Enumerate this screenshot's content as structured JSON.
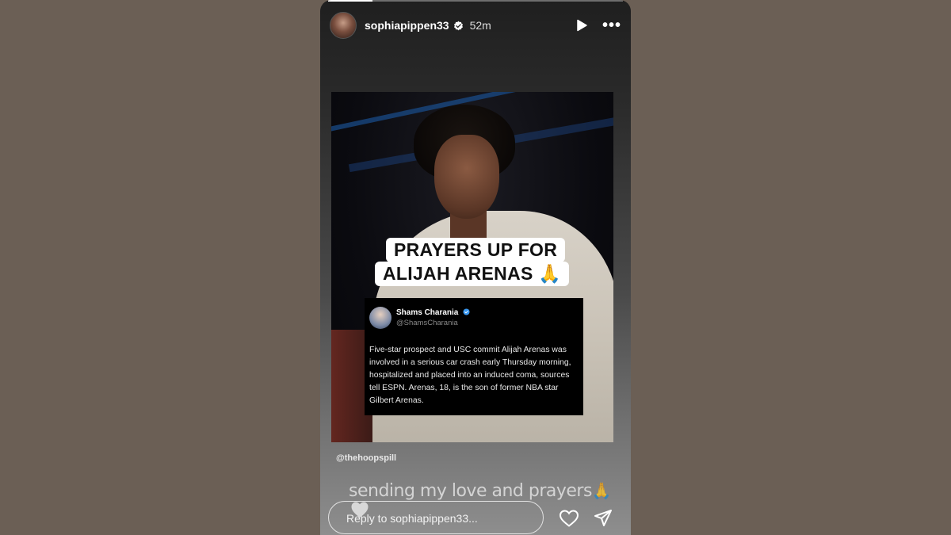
{
  "story": {
    "username": "sophiapippen33",
    "time": "52m",
    "progress_fraction": 0.15,
    "icons": {
      "play": "play-icon",
      "more": "more-icon",
      "verified": "verified-badge-icon"
    }
  },
  "post": {
    "headline_line1": "PRAYERS UP FOR",
    "headline_line2": "ALIJAH ARENAS",
    "headline_emoji": "🙏",
    "tweet": {
      "name": "Shams Charania",
      "handle": "@ShamsCharania",
      "text": "Five-star prospect and USC commit Alijah Arenas was involved in a serious car crash early Thursday morning, hospitalized and placed into an induced coma, sources tell ESPN. Arenas, 18, is the son of former NBA star Gilbert Arenas."
    },
    "mention": "@thehoopspill"
  },
  "caption": {
    "text": "sending my love and prayers",
    "emoji_pray": "🙏",
    "icon_heart": "white-heart-icon"
  },
  "footer": {
    "reply_placeholder": "Reply to sophiapippen33...",
    "icons": {
      "like": "heart-icon",
      "send": "send-icon"
    }
  },
  "colors": {
    "background": "#6b5f55",
    "verified_blue": "#3897f0",
    "text_white": "#ffffff"
  }
}
